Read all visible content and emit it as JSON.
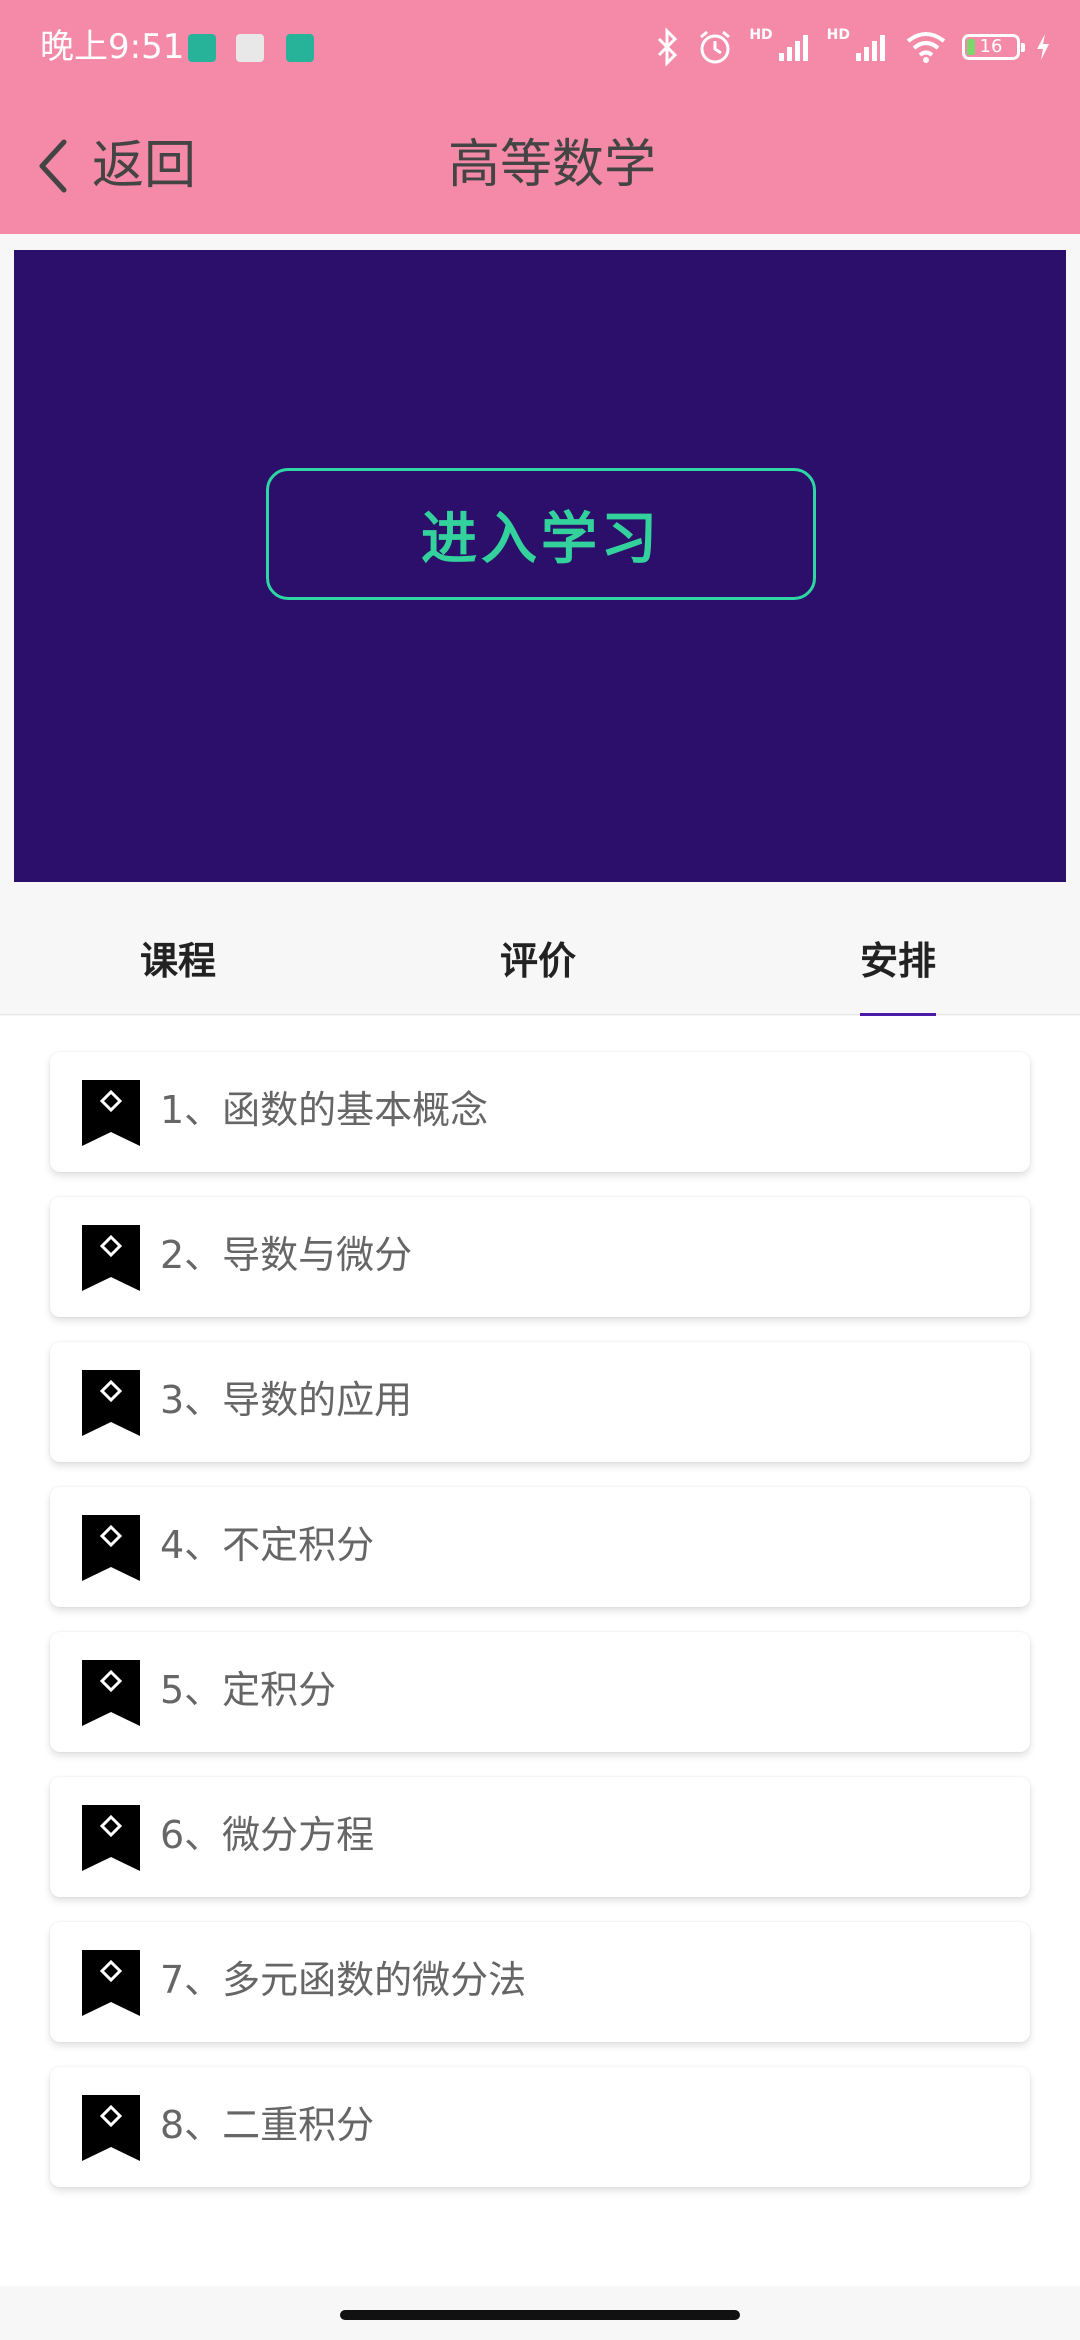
{
  "status_bar": {
    "time": "晚上9:51",
    "battery": "16",
    "signal_label": "HD"
  },
  "header": {
    "back_label": "返回",
    "title": "高等数学"
  },
  "hero": {
    "button_label": "进入学习"
  },
  "tabs": [
    {
      "label": "课程",
      "selected": false
    },
    {
      "label": "评价",
      "selected": false
    },
    {
      "label": "安排",
      "selected": true
    }
  ],
  "schedule": [
    {
      "label": "1、函数的基本概念"
    },
    {
      "label": "2、导数与微分"
    },
    {
      "label": "3、导数的应用"
    },
    {
      "label": "4、不定积分"
    },
    {
      "label": "5、定积分"
    },
    {
      "label": "6、微分方程"
    },
    {
      "label": "7、多元函数的微分法"
    },
    {
      "label": "8、二重积分"
    }
  ],
  "colors": {
    "header_bg": "#f48aa8",
    "hero_bg": "#2b0f6b",
    "accent_green": "#33d29c",
    "tab_indicator": "#4a1aa8"
  }
}
